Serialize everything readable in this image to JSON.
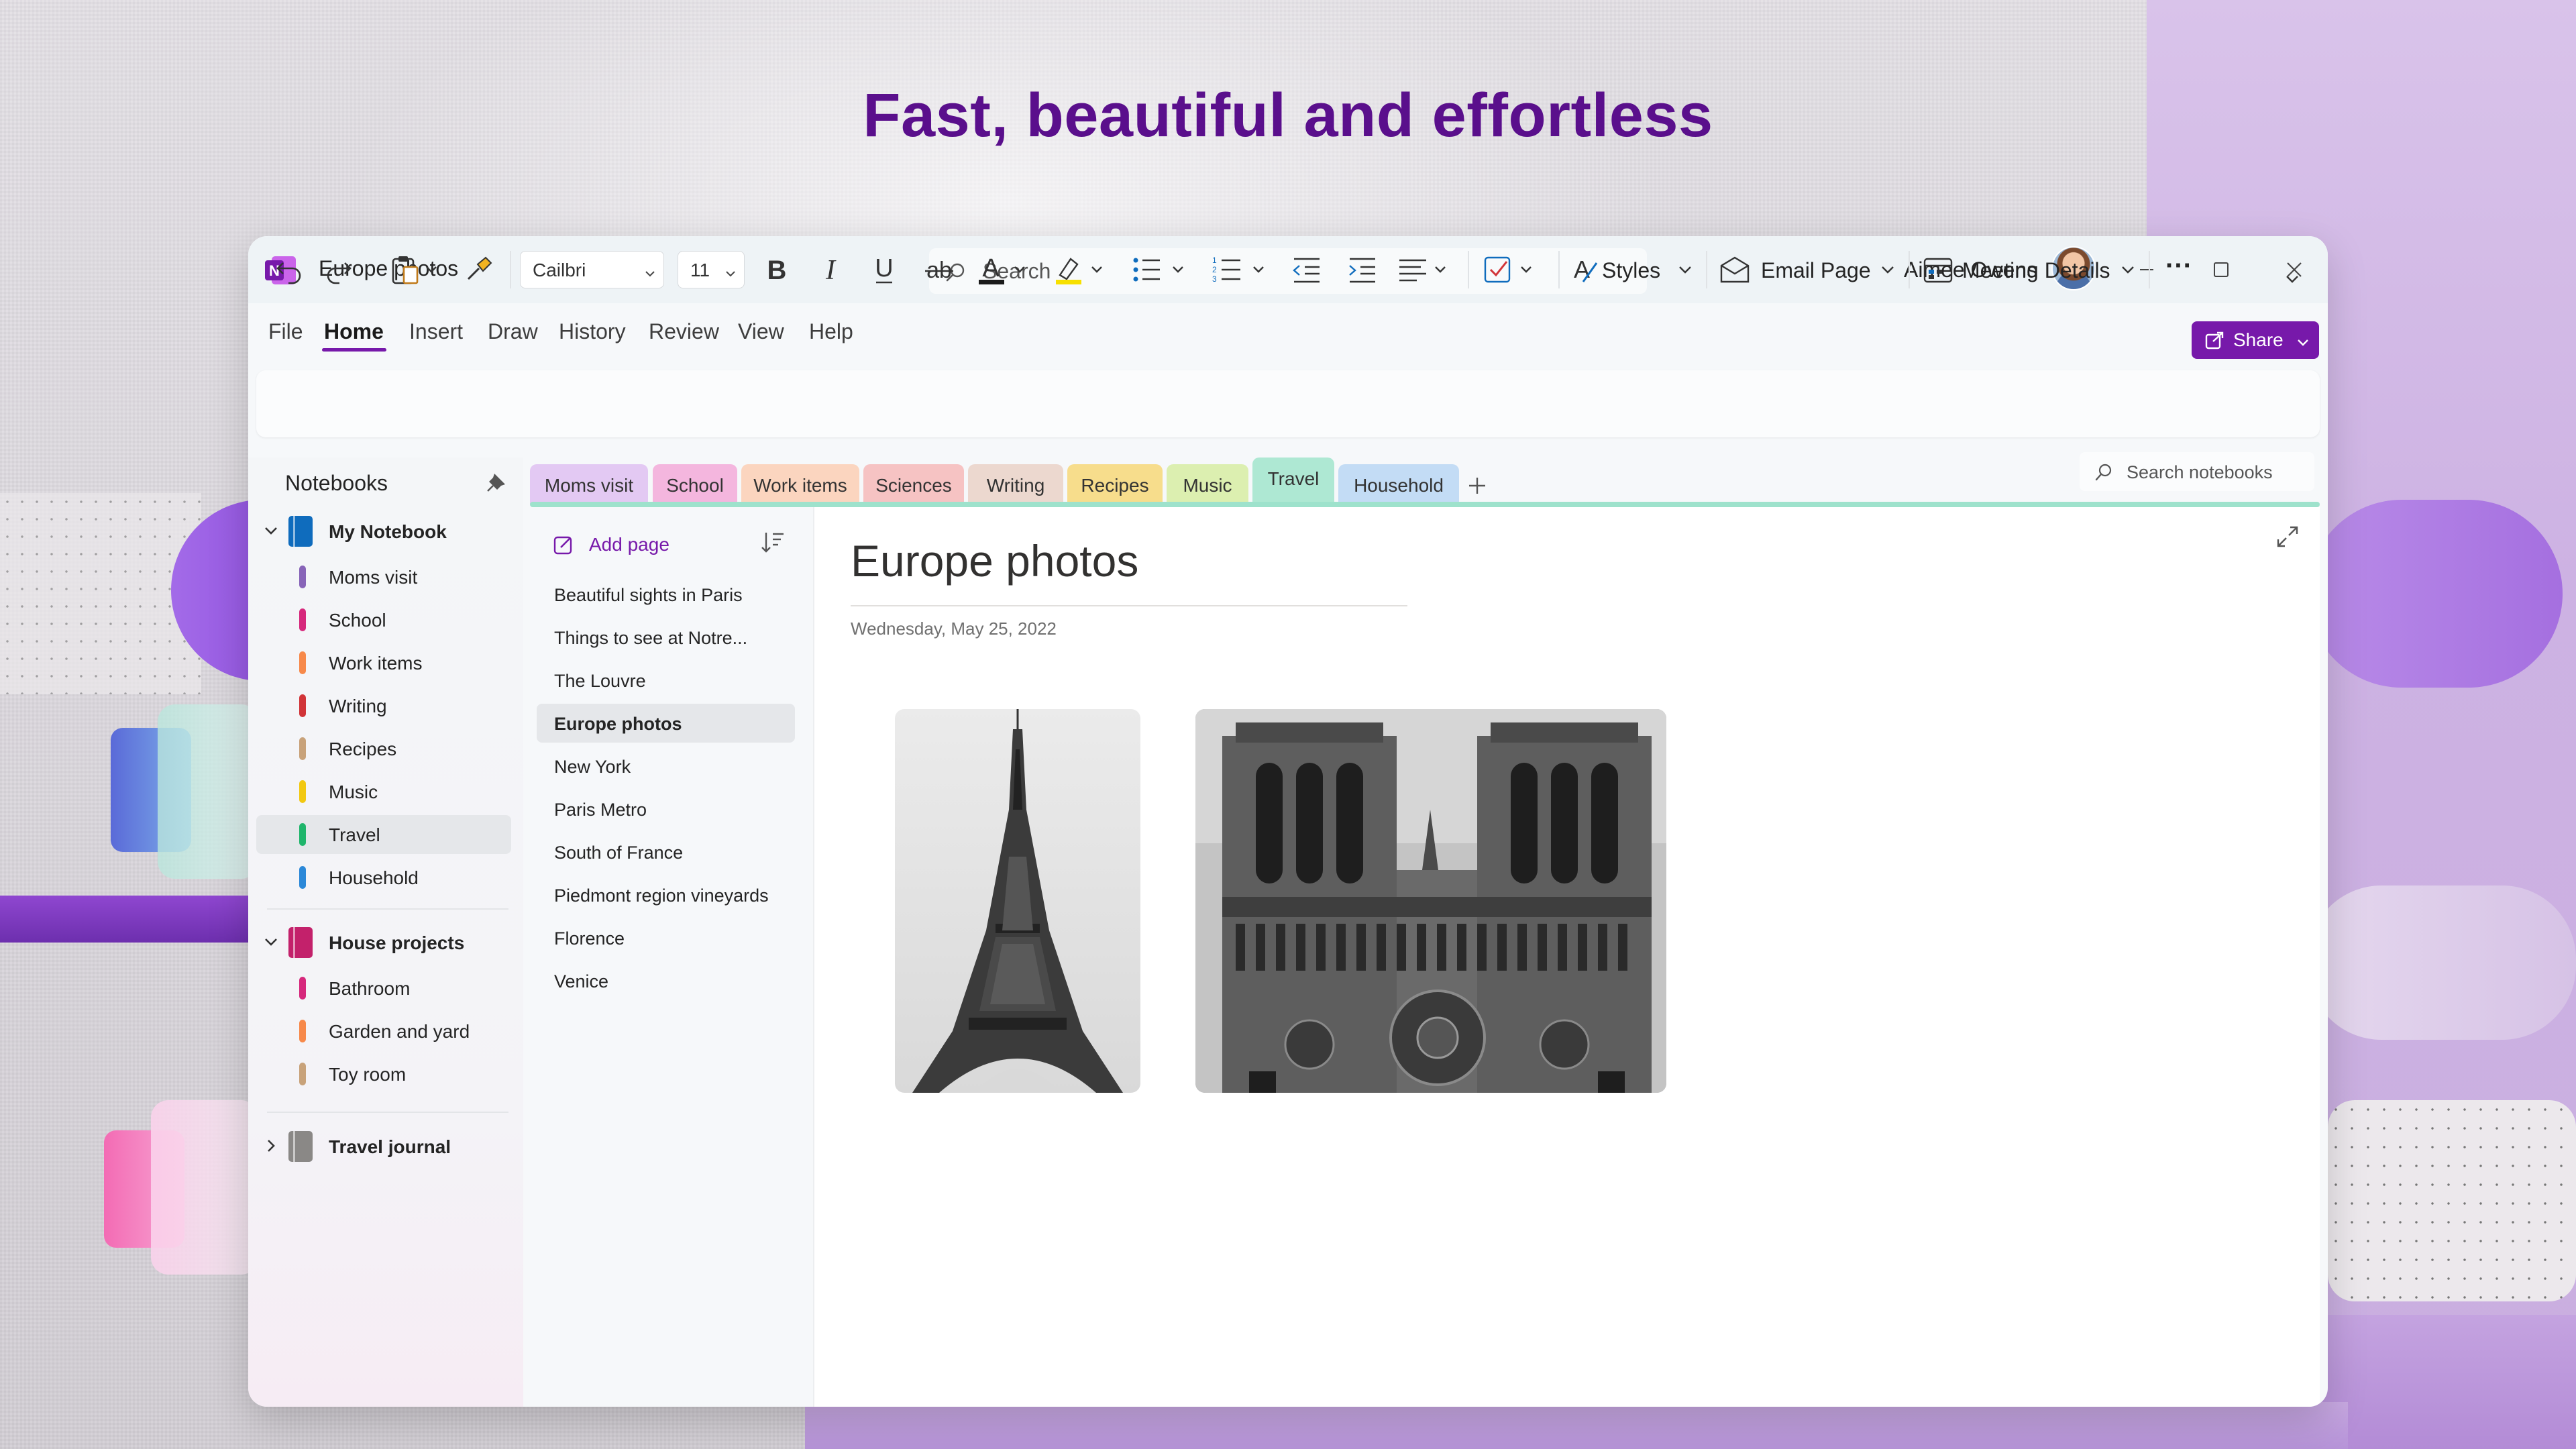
{
  "hero": {
    "title": "Fast, beautiful and effortless"
  },
  "window": {
    "title": "Europe photos",
    "search_placeholder": "Search",
    "user_name": "Aimee Owens"
  },
  "menu": {
    "items": [
      "File",
      "Home",
      "Insert",
      "Draw",
      "History",
      "Review",
      "View",
      "Help"
    ],
    "active": "Home",
    "share_label": "Share"
  },
  "toolbar": {
    "font_name": "Cailbri",
    "font_size": "11",
    "styles_label": "Styles",
    "email_label": "Email Page",
    "meeting_label": "Meeting Details",
    "more_label": "···"
  },
  "nav": {
    "heading": "Notebooks",
    "notebooks": [
      {
        "name": "My Notebook",
        "color": "#0f6cbd",
        "expanded": true,
        "sections": [
          {
            "name": "Moms visit",
            "color": "#8764b8"
          },
          {
            "name": "School",
            "color": "#d6287c"
          },
          {
            "name": "Work items",
            "color": "#f7894a"
          },
          {
            "name": "Writing",
            "color": "#d13438"
          },
          {
            "name": "Recipes",
            "color": "#c8a27a"
          },
          {
            "name": "Music",
            "color": "#f2c811"
          },
          {
            "name": "Travel",
            "color": "#1fb56b",
            "selected": true
          },
          {
            "name": "Household",
            "color": "#2b88d8"
          }
        ]
      },
      {
        "name": "House projects",
        "color": "#c3216b",
        "expanded": true,
        "sections": [
          {
            "name": "Bathroom",
            "color": "#d6287c"
          },
          {
            "name": "Garden and yard",
            "color": "#f7894a"
          },
          {
            "name": "Toy room",
            "color": "#c8a27a"
          }
        ]
      },
      {
        "name": "Travel journal",
        "color": "#8a8886",
        "expanded": false,
        "sections": []
      }
    ]
  },
  "tabs": [
    {
      "label": "Moms visit",
      "color": "#e3c9f3"
    },
    {
      "label": "School",
      "color": "#f4b6de"
    },
    {
      "label": "Work items",
      "color": "#fbd5bf"
    },
    {
      "label": "Sciences",
      "color": "#f6c3c3"
    },
    {
      "label": "Writing",
      "color": "#ecd8cf"
    },
    {
      "label": "Recipes",
      "color": "#f7dd8c"
    },
    {
      "label": "Music",
      "color": "#dcefb0"
    },
    {
      "label": "Travel",
      "color": "#aee8d3",
      "active": true
    },
    {
      "label": "Household",
      "color": "#c3dcf5"
    }
  ],
  "notebook_search_placeholder": "Search notebooks",
  "pages": {
    "add_label": "Add page",
    "items": [
      "Beautiful sights in Paris",
      "Things to see at Notre...",
      "The Louvre",
      "Europe photos",
      "New York",
      "Paris Metro",
      "South of France",
      "Piedmont region vineyards",
      "Florence",
      "Venice"
    ],
    "selected": "Europe photos"
  },
  "page": {
    "title": "Europe photos",
    "date": "Wednesday, May 25, 2022"
  },
  "colors": {
    "accent": "#7719aa",
    "hero": "#5a0f8c",
    "travel_tab_line": "#9ee2cc"
  }
}
